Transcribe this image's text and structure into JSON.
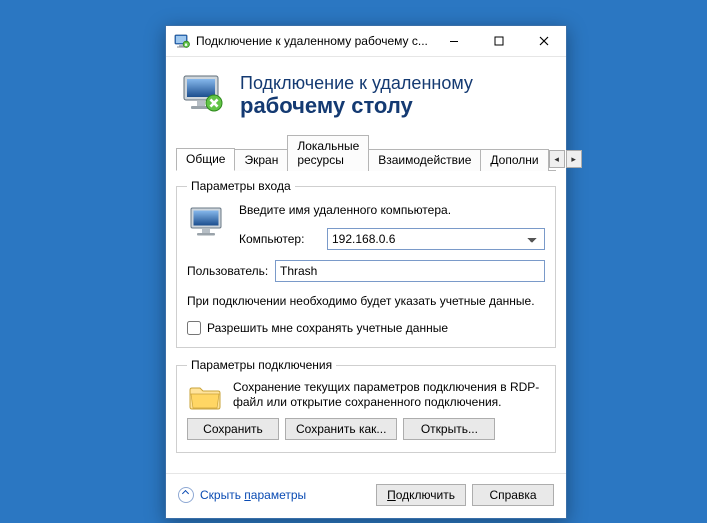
{
  "titlebar": {
    "title": "Подключение к удаленному рабочему с..."
  },
  "header": {
    "line1": "Подключение к удаленному",
    "line2": "рабочему столу"
  },
  "tabs": {
    "items": [
      "Общие",
      "Экран",
      "Локальные ресурсы",
      "Взаимодействие",
      "Дополни"
    ],
    "active_index": 0
  },
  "login_group": {
    "legend": "Параметры входа",
    "instruction": "Введите имя удаленного компьютера.",
    "computer_label": "Компьютер:",
    "computer_value": "192.168.0.6",
    "user_label": "Пользователь:",
    "user_value": "Thrash",
    "hint": "При подключении необходимо будет указать учетные данные.",
    "remember_label": "Разрешить мне сохранять учетные данные"
  },
  "conn_group": {
    "legend": "Параметры подключения",
    "text": "Сохранение текущих параметров подключения в RDP-файл или открытие сохраненного подключения.",
    "save": "Сохранить",
    "save_as": "Сохранить как...",
    "open": "Открыть..."
  },
  "footer": {
    "hide_prefix": "Скрыть ",
    "hide_uline": "п",
    "hide_suffix": "араметры",
    "connect_uline": "П",
    "connect_suffix": "одключить",
    "help": "Справка"
  }
}
